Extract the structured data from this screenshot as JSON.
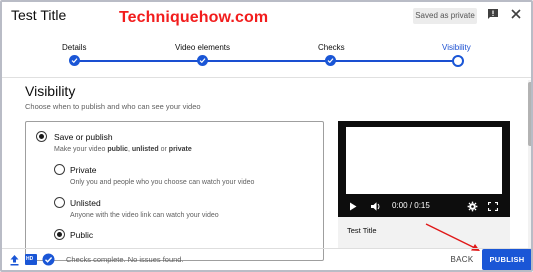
{
  "header": {
    "title": "Test Title",
    "watermark": "Techniquehow.com",
    "saved_badge": "Saved as private",
    "feedback_icon": "feedback-icon",
    "close_icon": "close-icon"
  },
  "stepper": {
    "steps": [
      {
        "label": "Details",
        "state": "done"
      },
      {
        "label": "Video elements",
        "state": "done"
      },
      {
        "label": "Checks",
        "state": "done"
      },
      {
        "label": "Visibility",
        "state": "current"
      }
    ],
    "accent": "#1a56d6"
  },
  "visibility": {
    "title": "Visibility",
    "subtitle": "Choose when to publish and who can see your video",
    "save_or_publish": {
      "label": "Save or publish",
      "desc_prefix": "Make your video ",
      "desc_public": "public",
      "desc_sep": ", ",
      "desc_unlisted": "unlisted",
      "desc_or": " or ",
      "desc_private": "private",
      "selected": true
    },
    "options": [
      {
        "label": "Private",
        "desc": "Only you and people who you choose can watch your video",
        "selected": false
      },
      {
        "label": "Unlisted",
        "desc": "Anyone with the video link can watch your video",
        "selected": false
      },
      {
        "label": "Public",
        "desc": "",
        "selected": true
      }
    ]
  },
  "preview": {
    "time": "0:00 / 0:15",
    "video_title": "Test Title",
    "icons": [
      "play-icon",
      "volume-icon",
      "settings-icon",
      "fullscreen-icon"
    ]
  },
  "footer": {
    "status": "Checks complete. No issues found.",
    "back_label": "BACK",
    "publish_label": "PUBLISH",
    "hd_label": "HD"
  }
}
